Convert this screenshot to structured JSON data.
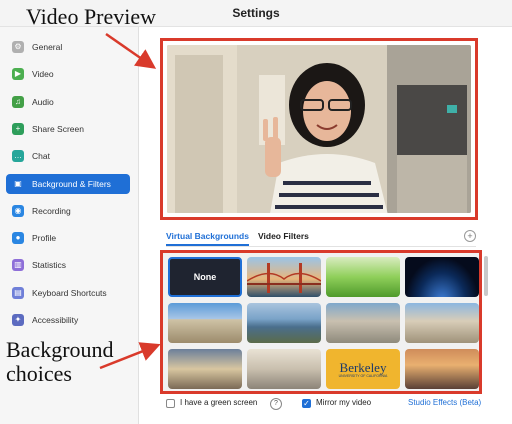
{
  "window": {
    "title": "Settings"
  },
  "sidebar": {
    "items": [
      {
        "label": "General",
        "icon": "gear-icon",
        "color": "#b0b0b0",
        "glyph": "⚙"
      },
      {
        "label": "Video",
        "icon": "video-camera-icon",
        "color": "#4caf50",
        "glyph": "▶"
      },
      {
        "label": "Audio",
        "icon": "headphones-icon",
        "color": "#43a047",
        "glyph": "♫"
      },
      {
        "label": "Share Screen",
        "icon": "share-screen-icon",
        "color": "#2e9e5b",
        "glyph": "+"
      },
      {
        "label": "Chat",
        "icon": "chat-bubble-icon",
        "color": "#26a69a",
        "glyph": "…"
      },
      {
        "label": "Background & Filters",
        "icon": "person-background-icon",
        "color": "#1f6fd6",
        "glyph": "▣"
      },
      {
        "label": "Recording",
        "icon": "record-icon",
        "color": "#2a86e2",
        "glyph": "◉"
      },
      {
        "label": "Profile",
        "icon": "person-icon",
        "color": "#2a86e2",
        "glyph": "●"
      },
      {
        "label": "Statistics",
        "icon": "bar-chart-icon",
        "color": "#8e6fd8",
        "glyph": "▥"
      },
      {
        "label": "Keyboard Shortcuts",
        "icon": "keyboard-icon",
        "color": "#6f7fd8",
        "glyph": "▤"
      },
      {
        "label": "Accessibility",
        "icon": "accessibility-icon",
        "color": "#5c6bc0",
        "glyph": "✦"
      }
    ],
    "active_index": 5
  },
  "annotations": {
    "video_preview": "Video Preview",
    "background_choices": "Background choices",
    "border_color": "#d93a2b"
  },
  "tabs": [
    {
      "label": "Virtual Backgrounds",
      "active": true
    },
    {
      "label": "Video Filters",
      "active": false
    }
  ],
  "backgrounds": {
    "none_label": "None",
    "thumbnails": [
      {
        "name": "none",
        "kind": "none"
      },
      {
        "name": "golden-gate-bridge",
        "kind": "image"
      },
      {
        "name": "grass",
        "kind": "image"
      },
      {
        "name": "earth-from-space",
        "kind": "image"
      },
      {
        "name": "campus-building",
        "kind": "image"
      },
      {
        "name": "bay-view",
        "kind": "image"
      },
      {
        "name": "campus-aerial",
        "kind": "image"
      },
      {
        "name": "campus-plaza",
        "kind": "image"
      },
      {
        "name": "sather-tower",
        "kind": "image"
      },
      {
        "name": "library-dome",
        "kind": "image"
      },
      {
        "name": "city-skyline",
        "kind": "image"
      },
      {
        "name": "berkeley-logo",
        "kind": "logo",
        "logo_text": "Berkeley",
        "logo_sub": "UNIVERSITY OF CALIFORNIA"
      },
      {
        "name": "sunset-campus",
        "kind": "image"
      }
    ]
  },
  "footer": {
    "green_screen_label": "I have a green screen",
    "green_screen_checked": false,
    "mirror_label": "Mirror my video",
    "mirror_checked": true,
    "studio_effects_label": "Studio Effects (Beta)",
    "help_glyph": "?"
  },
  "colors": {
    "accent": "#1f6fd6",
    "annotation": "#d93a2b"
  }
}
